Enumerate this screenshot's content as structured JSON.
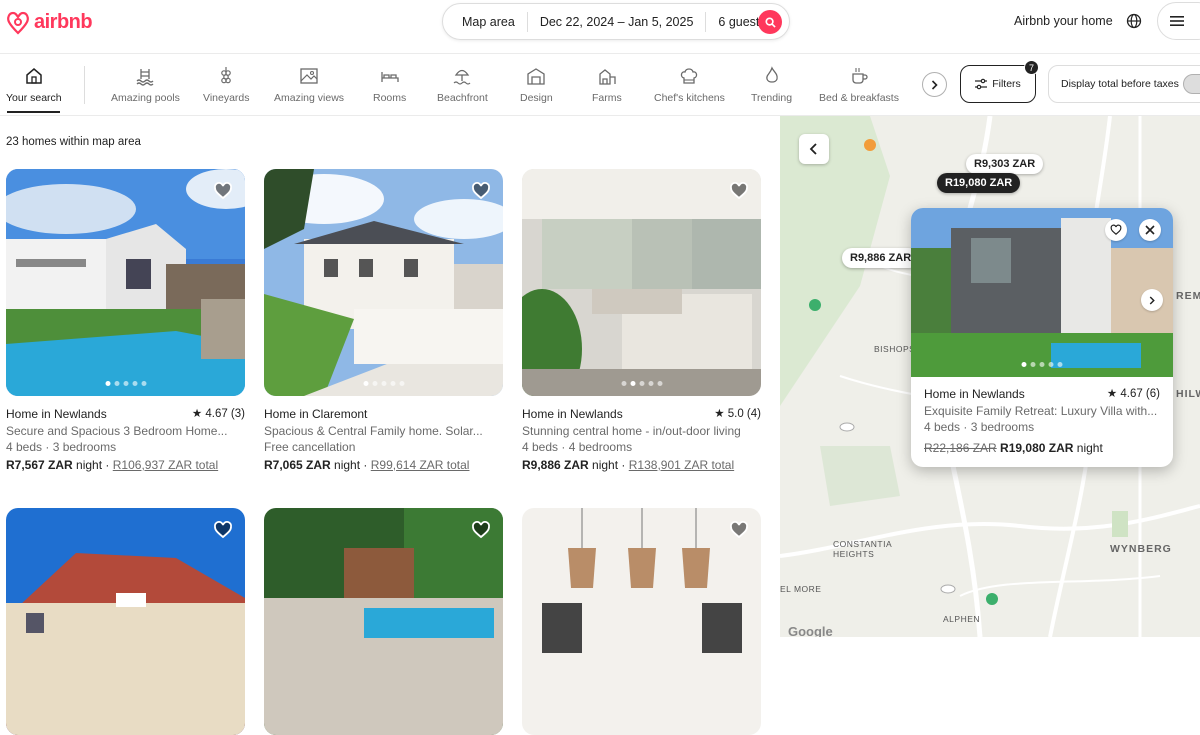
{
  "brand": {
    "name": "airbnb",
    "color": "#ff385c"
  },
  "search": {
    "where": "Map area",
    "dates": "Dec 22, 2024 – Jan 5, 2025",
    "guests": "6 guests"
  },
  "header": {
    "host_link": "Airbnb your home"
  },
  "categories": [
    {
      "label": "Your search",
      "icon": "home-icon",
      "active": true
    },
    {
      "label": "Amazing pools",
      "icon": "pool-icon"
    },
    {
      "label": "Vineyards",
      "icon": "grapes-icon"
    },
    {
      "label": "Amazing views",
      "icon": "view-icon"
    },
    {
      "label": "Rooms",
      "icon": "bed-icon"
    },
    {
      "label": "Beachfront",
      "icon": "beach-icon"
    },
    {
      "label": "Design",
      "icon": "design-icon"
    },
    {
      "label": "Farms",
      "icon": "farm-icon"
    },
    {
      "label": "Chef's kitchens",
      "icon": "chef-hat-icon"
    },
    {
      "label": "Trending",
      "icon": "flame-icon"
    },
    {
      "label": "Bed & breakfasts",
      "icon": "coffee-icon"
    }
  ],
  "filters": {
    "label": "Filters",
    "count": "7"
  },
  "taxes_toggle": {
    "label": "Display total before taxes"
  },
  "results": {
    "count_text": "23 homes within map area"
  },
  "listings": [
    {
      "title": "Home in Newlands",
      "rating": "4.67 (3)",
      "subtitle": "Secure and Spacious 3 Bedroom Home...",
      "details": "4 beds · 3 bedrooms",
      "price": "R7,567 ZAR",
      "price_unit": "night",
      "total": "R106,937 ZAR total"
    },
    {
      "title": "Home in Claremont",
      "rating": "",
      "subtitle": "Spacious & Central Family home. Solar...",
      "details": "Free cancellation",
      "price": "R7,065 ZAR",
      "price_unit": "night",
      "total": "R99,614 ZAR total"
    },
    {
      "title": "Home in Newlands",
      "rating": "5.0 (4)",
      "subtitle": "Stunning central home - in/out-door living",
      "details": "4 beds · 4 bedrooms",
      "price": "R9,886 ZAR",
      "price_unit": "night",
      "total": "R138,901 ZAR total"
    }
  ],
  "map": {
    "pins": [
      "R9,303 ZAR",
      "R19,080 ZAR",
      "R9,886 ZAR"
    ],
    "labels": [
      "BISHOPS",
      "CONSTANTIA HEIGHTS",
      "WYNBERG",
      "EL MORE",
      "ALPHEN",
      "REMO",
      "HILWO"
    ],
    "attribution": "Google"
  },
  "popup": {
    "title": "Home in Newlands",
    "rating": "4.67 (6)",
    "subtitle": "Exquisite Family Retreat: Luxury Villa with...",
    "details": "4 beds · 3 bedrooms",
    "old_price": "R22,186 ZAR",
    "price": "R19,080 ZAR",
    "price_unit": "night"
  }
}
